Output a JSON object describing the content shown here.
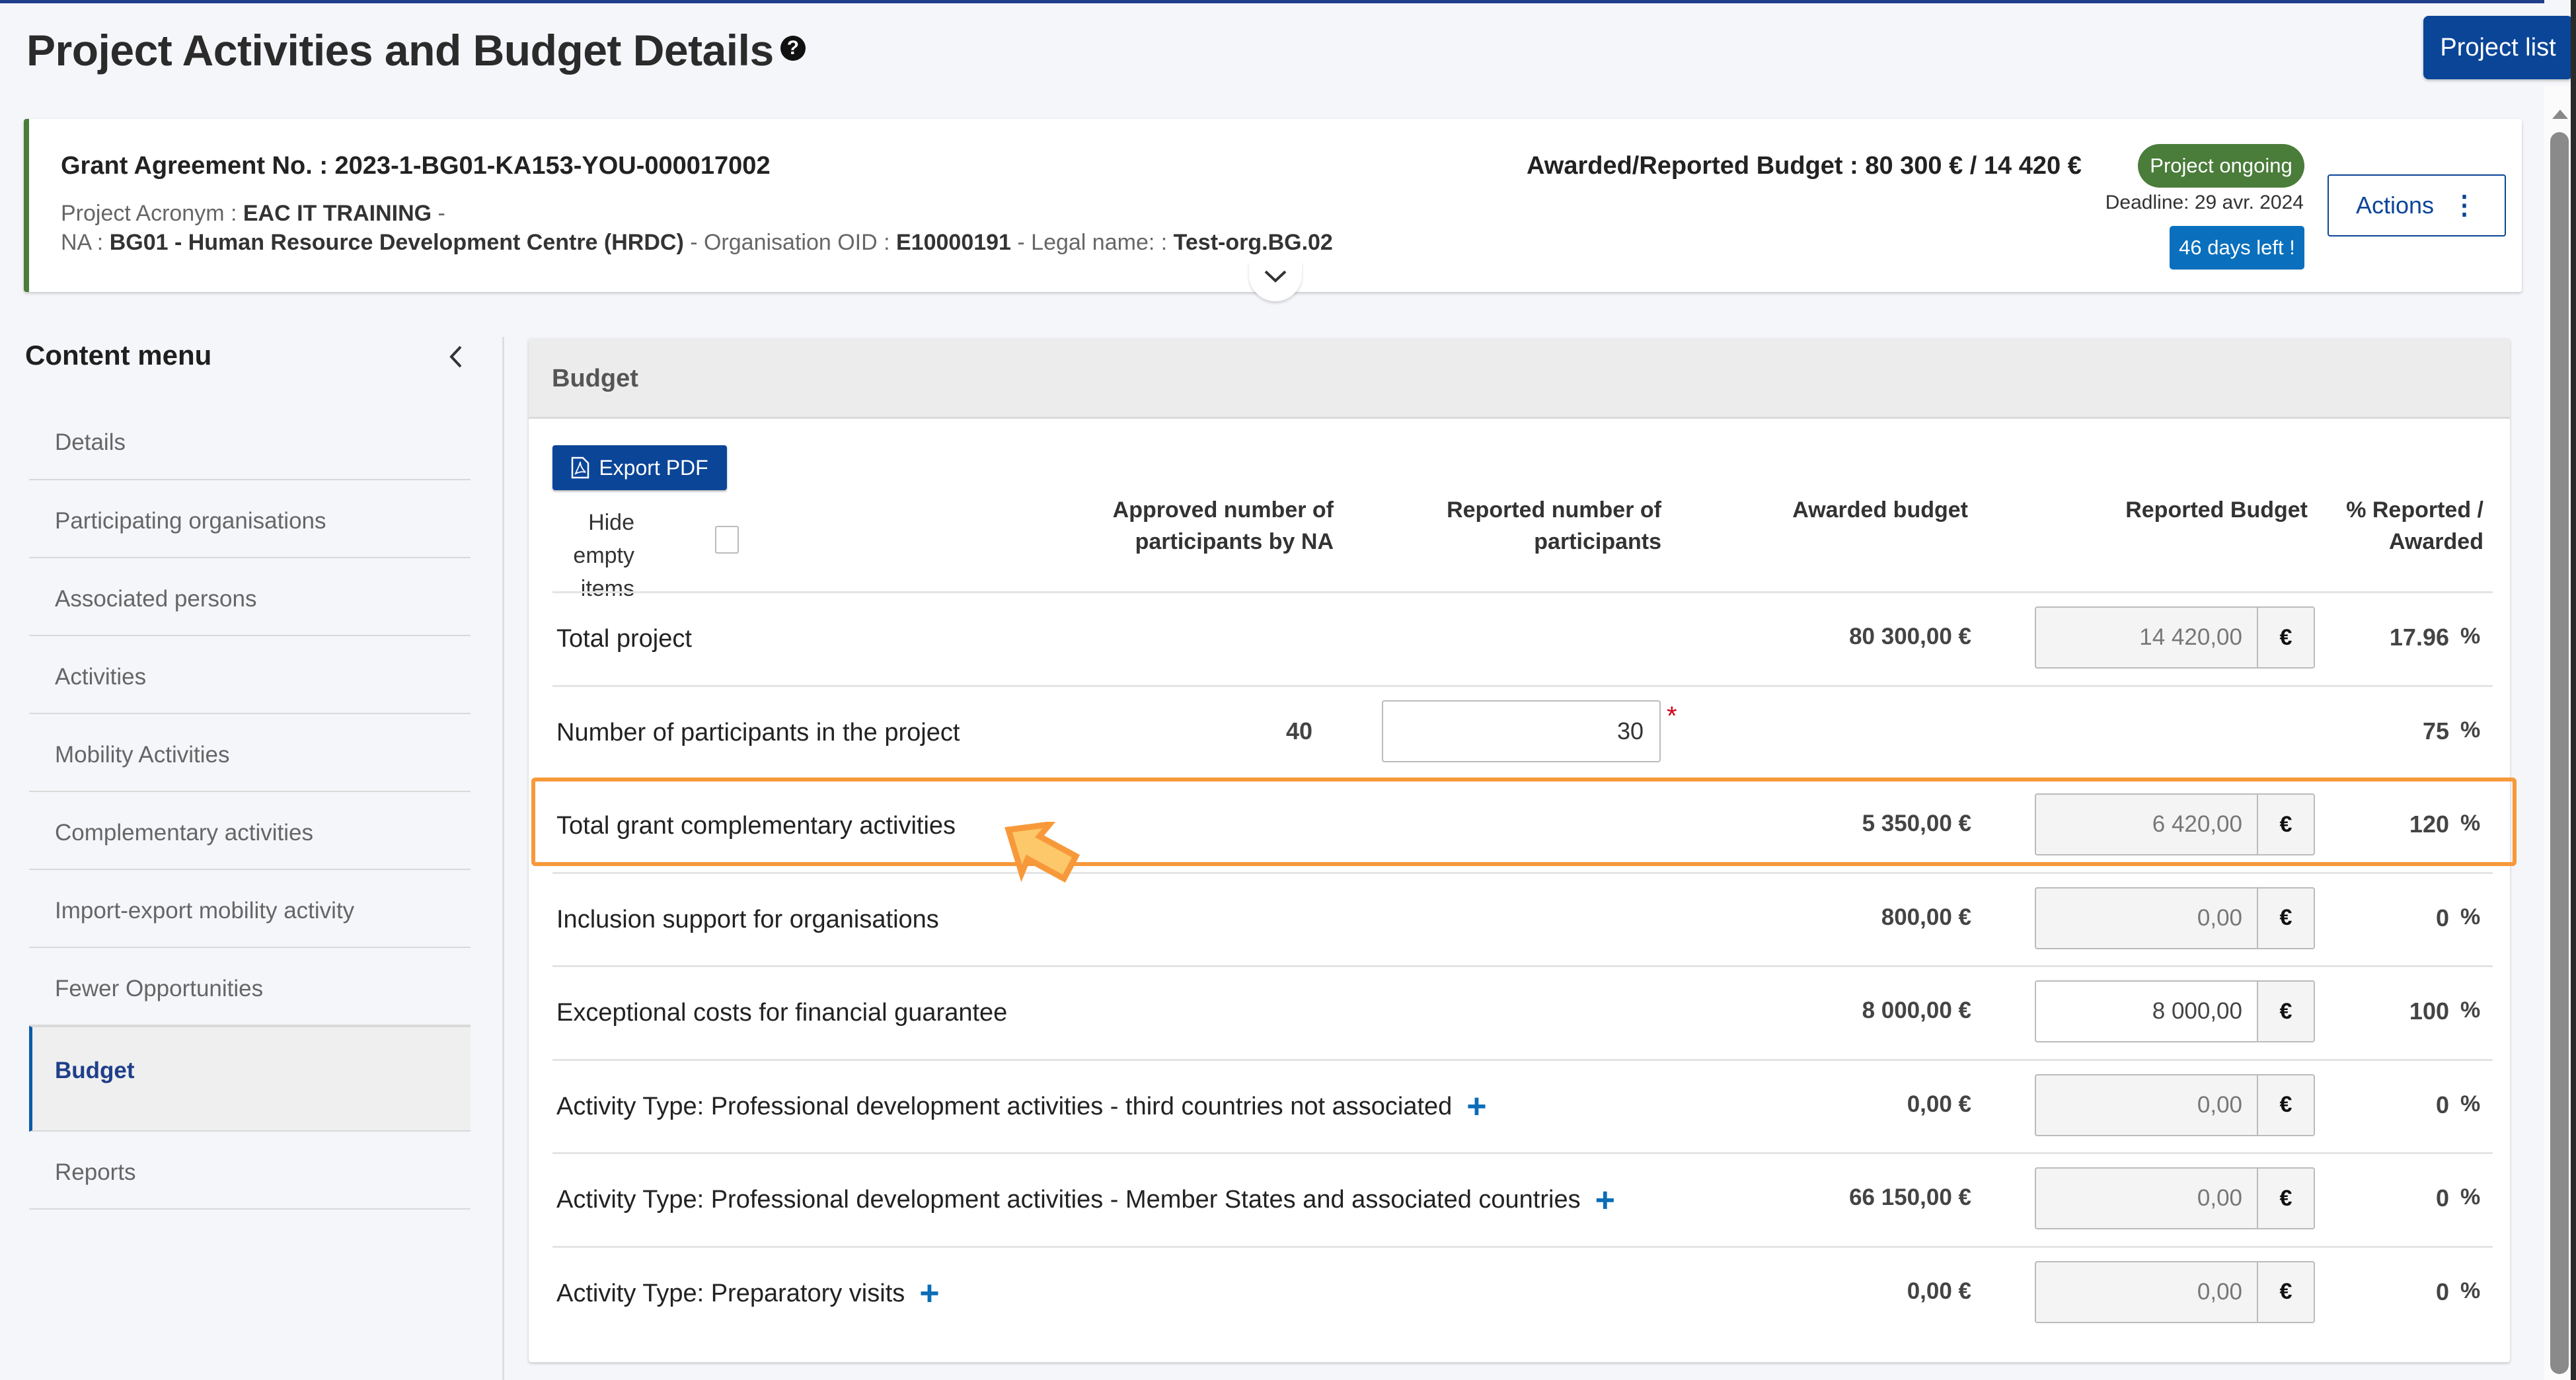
{
  "page": {
    "title": "Project Activities and Budget Details",
    "help_icon": "question-circle-icon",
    "project_list_label": "Project list"
  },
  "grant": {
    "agreement_no": "Grant Agreement No. : 2023-1-BG01-KA153-YOU-000017002",
    "acronym_label": "Project Acronym : ",
    "acronym_value": "EAC IT TRAINING",
    "acronym_suffix": " -",
    "na_label": "NA : ",
    "na_value": "BG01 - Human Resource Development Centre (HRDC)",
    "oid_label": " - Organisation OID : ",
    "oid_value": "E10000191",
    "legal_label": " - Legal name: : ",
    "legal_value": "Test-org.BG.02",
    "budget_summary": "Awarded/Reported Budget : 80 300 € / 14 420 €",
    "status": "Project ongoing",
    "deadline": "Deadline: 29 avr. 2024",
    "days_left": "46 days left !",
    "actions_label": "Actions",
    "colors": {
      "status": "#4a7c3a",
      "days_left": "#0a70bd",
      "primary": "#0b4598"
    }
  },
  "sidebar": {
    "title": "Content menu",
    "items": [
      {
        "label": "Details",
        "active": false
      },
      {
        "label": "Participating organisations",
        "active": false
      },
      {
        "label": "Associated persons",
        "active": false
      },
      {
        "label": "Activities",
        "active": false
      },
      {
        "label": "Mobility Activities",
        "active": false
      },
      {
        "label": "Complementary activities",
        "active": false
      },
      {
        "label": "Import-export mobility activity",
        "active": false
      },
      {
        "label": "Fewer Opportunities",
        "active": false
      },
      {
        "label": "Budget",
        "active": true
      },
      {
        "label": "Reports",
        "active": false
      }
    ]
  },
  "budget": {
    "panel_title": "Budget",
    "export_label": "Export PDF",
    "hide_empty_label": "Hide empty items",
    "hide_empty_checked": false,
    "columns": {
      "approved": "Approved number of participants by NA",
      "reported_participants": "Reported number of participants",
      "awarded": "Awarded budget",
      "reported_budget": "Reported Budget",
      "percent": "% Reported / Awarded"
    },
    "currency": "€",
    "percent_sign": "%",
    "rows": [
      {
        "label": "Total project",
        "approved": "",
        "reported_participants": "",
        "awarded": "80 300,00 €",
        "reported": "14 420,00",
        "reported_editable": false,
        "percent": "17.96",
        "has_plus": false
      },
      {
        "label": "Number of participants in the project",
        "approved": "40",
        "reported_participants": "30",
        "awarded": "",
        "reported": null,
        "percent": "75",
        "has_plus": false,
        "required": true
      },
      {
        "label": "Total grant complementary activities",
        "approved": "",
        "reported_participants": "",
        "awarded": "5 350,00 €",
        "reported": "6 420,00",
        "reported_editable": false,
        "percent": "120",
        "has_plus": false,
        "highlighted": true
      },
      {
        "label": "Inclusion support for organisations",
        "approved": "",
        "reported_participants": "",
        "awarded": "800,00 €",
        "reported": "0,00",
        "reported_editable": false,
        "percent": "0",
        "has_plus": false
      },
      {
        "label": "Exceptional costs for financial guarantee",
        "approved": "",
        "reported_participants": "",
        "awarded": "8 000,00 €",
        "reported": "8 000,00",
        "reported_editable": true,
        "percent": "100",
        "has_plus": false
      },
      {
        "label": "Activity Type: Professional development activities - third countries not associated",
        "approved": "",
        "reported_participants": "",
        "awarded": "0,00 €",
        "reported": "0,00",
        "reported_editable": false,
        "percent": "0",
        "has_plus": true
      },
      {
        "label": "Activity Type: Professional development activities - Member States and associated countries",
        "approved": "",
        "reported_participants": "",
        "awarded": "66 150,00 €",
        "reported": "0,00",
        "reported_editable": false,
        "percent": "0",
        "has_plus": true
      },
      {
        "label": "Activity Type: Preparatory visits",
        "approved": "",
        "reported_participants": "",
        "awarded": "0,00 €",
        "reported": "0,00",
        "reported_editable": false,
        "percent": "0",
        "has_plus": true
      }
    ],
    "highlight_color": "#f7993a"
  }
}
